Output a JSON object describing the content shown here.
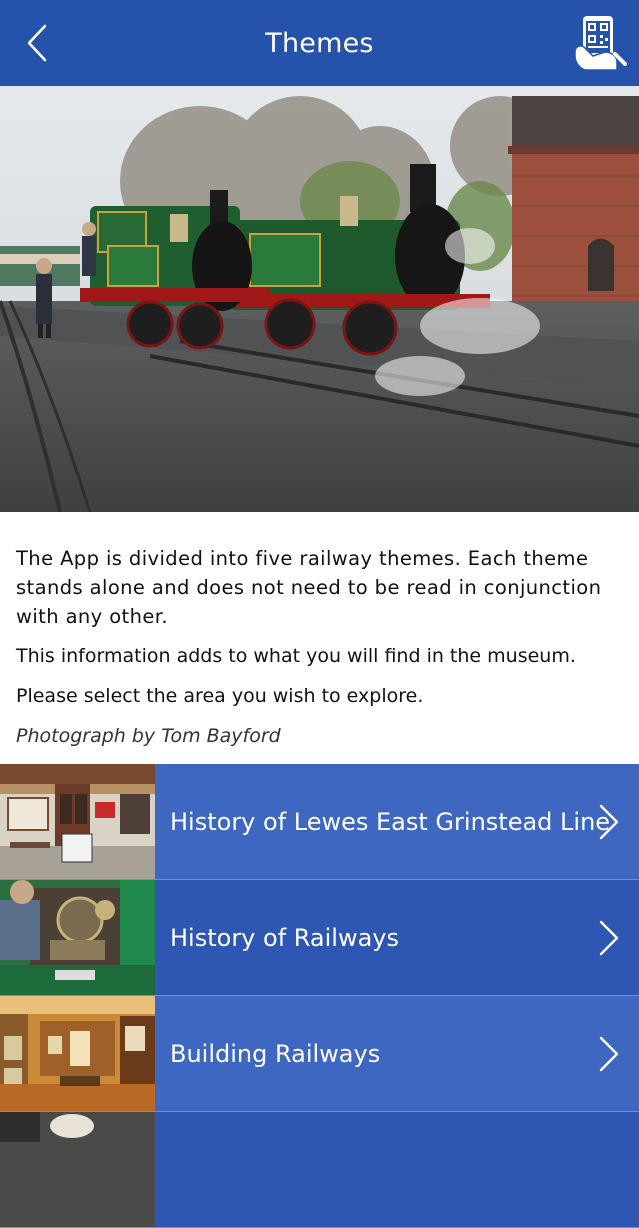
{
  "header": {
    "title": "Themes",
    "back_icon": "chevron-left-icon",
    "qr_icon": "qr-scan-icon"
  },
  "hero": {
    "description": "Two green steam locomotives beside a brick water tower"
  },
  "intro": {
    "paragraph1": "The App is divided into five railway themes. Each theme stands alone and does not need to be read in conjunction with any other.",
    "paragraph2": "This information adds to what you will find in the museum.",
    "paragraph3": "Please select the area you wish to explore.",
    "credit": "Photograph by Tom Bayford"
  },
  "themes": [
    {
      "label": "History of Lewes East Grinstead Line"
    },
    {
      "label": "History of Railways"
    },
    {
      "label": "Building Railways"
    },
    {
      "label": ""
    }
  ],
  "colors": {
    "header": "#2553ac",
    "row_light": "#3d67c1",
    "row_dark": "#2e56b3"
  }
}
